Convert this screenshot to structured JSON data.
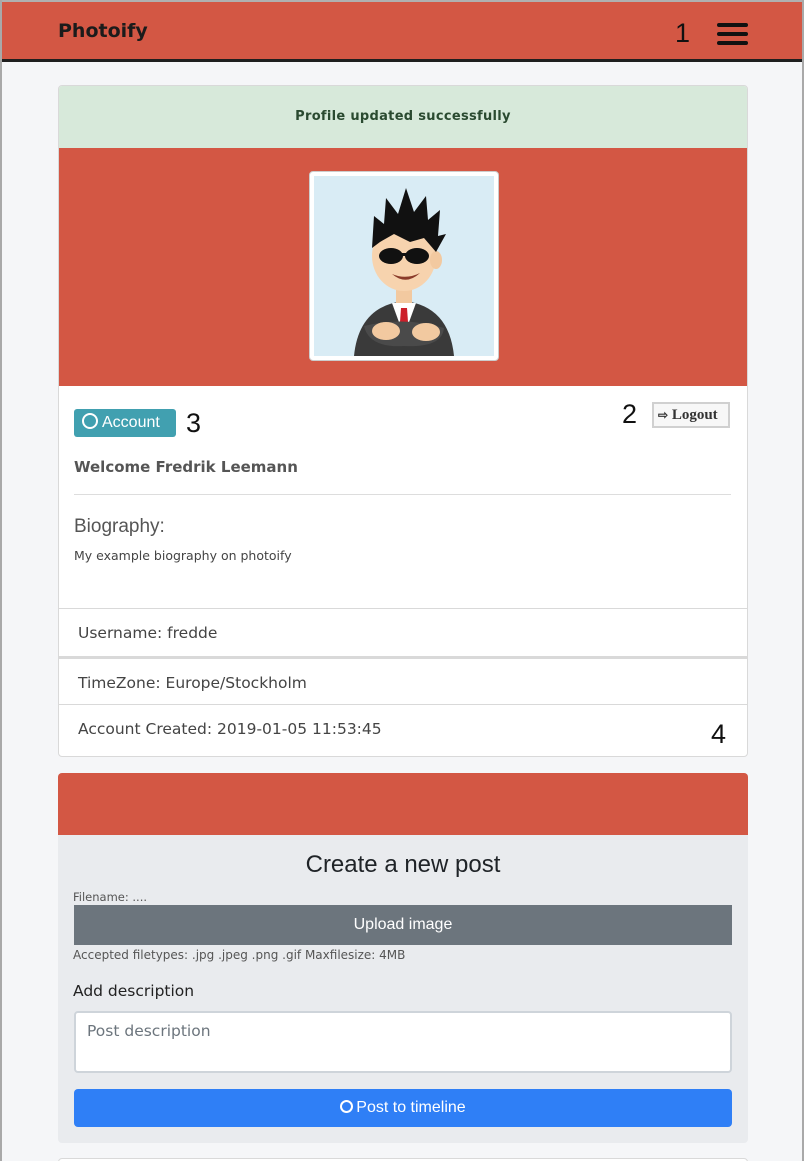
{
  "navbar": {
    "brand": "Photoify",
    "menu_icon": "hamburger-menu-icon"
  },
  "annotations": [
    "1",
    "2",
    "3",
    "4"
  ],
  "profile": {
    "alert": "Profile updated successfully",
    "avatar_icon": "profile-avatar-image",
    "account_button": "Account",
    "account_icon": "user-circle-icon",
    "logout_button": "Logout",
    "logout_icon": "sign-out-icon",
    "welcome": "Welcome Fredrik Leemann",
    "biography_title": "Biography:",
    "biography_text": "My example biography on photoify",
    "username": "Username: fredde",
    "timezone": "TimeZone: Europe/Stockholm",
    "account_created": "Account Created: 2019-01-05 11:53:45"
  },
  "post": {
    "title": "Create a new post",
    "filename": "Filename: ....",
    "upload_button": "Upload image",
    "accepted": "Accepted filetypes: .jpg .jpeg .png .gif Maxfilesize: 4MB",
    "description_label": "Add description",
    "description_placeholder": "Post description",
    "submit_button": "Post to timeline",
    "submit_icon": "arrow-circle-icon"
  },
  "colors": {
    "brand": "#d35744",
    "account_button": "#41a0b0",
    "post_button": "#2f7ff6",
    "upload_button": "#6c757d",
    "alert_bg": "#d7e9da"
  }
}
